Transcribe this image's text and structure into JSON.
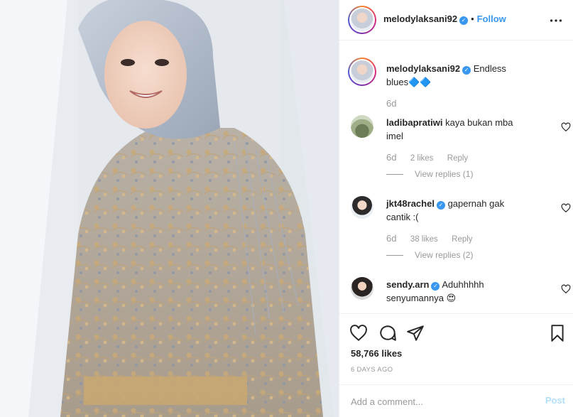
{
  "post": {
    "username": "melodylaksani92",
    "dot": "•",
    "follow_label": "Follow",
    "caption_line1": "Endless",
    "caption_line2": "blues",
    "caption_emoji": "🔷🔷",
    "caption_time": "6d"
  },
  "comments": [
    {
      "username": "ladibapratiwi",
      "verified": false,
      "text_line1": "kaya bukan mba",
      "text_line2": "imel",
      "time": "6d",
      "likes": "2 likes",
      "reply": "Reply",
      "view_replies": "View replies (1)"
    },
    {
      "username": "jkt48rachel",
      "verified": true,
      "text_line1": "gapernah gak",
      "text_line2": "cantik :(",
      "time": "6d",
      "likes": "38 likes",
      "reply": "Reply",
      "view_replies": "View replies (2)"
    },
    {
      "username": "sendy.arn",
      "verified": true,
      "text_line1": "Aduhhhhh",
      "text_line2": "senyumannya",
      "emoji": "😍"
    }
  ],
  "likes_count": "58,766 likes",
  "posted_ago": "6 DAYS AGO",
  "add_comment": {
    "placeholder": "Add a comment...",
    "post_label": "Post"
  },
  "icons": {
    "like": "heart-icon",
    "comment": "comment-icon",
    "share": "share-icon",
    "save": "bookmark-icon",
    "more": "more-options-icon",
    "verified": "verified-badge-icon"
  },
  "colors": {
    "link_blue": "#3897f0",
    "muted": "#999999",
    "post_disabled": "#b2dffc",
    "text": "#262626"
  }
}
